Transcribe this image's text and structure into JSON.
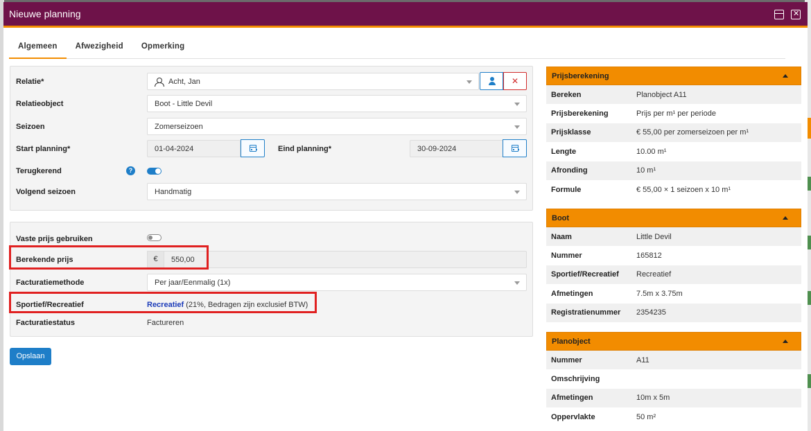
{
  "window": {
    "title": "Nieuwe planning"
  },
  "tabs": [
    {
      "label": "Algemeen",
      "active": true
    },
    {
      "label": "Afwezigheid",
      "active": false
    },
    {
      "label": "Opmerking",
      "active": false
    }
  ],
  "form": {
    "relatie": {
      "label": "Relatie*",
      "value": "Acht, Jan"
    },
    "relatieobject": {
      "label": "Relatieobject",
      "value": "Boot - Little Devil"
    },
    "seizoen": {
      "label": "Seizoen",
      "value": "Zomerseizoen"
    },
    "start_planning": {
      "label": "Start planning*",
      "value": "01-04-2024"
    },
    "eind_planning": {
      "label": "Eind planning*",
      "value": "30-09-2024"
    },
    "terugkerend": {
      "label": "Terugkerend",
      "help": "?",
      "enabled": true
    },
    "volgend_seizoen": {
      "label": "Volgend seizoen",
      "value": "Handmatig"
    }
  },
  "pricing": {
    "vaste_prijs": {
      "label": "Vaste prijs gebruiken",
      "enabled": false
    },
    "berekende_prijs": {
      "label": "Berekende prijs",
      "currency": "€",
      "value": "550,00"
    },
    "facturatiemethode": {
      "label": "Facturatiemethode",
      "value": "Per jaar/Eenmalig (1x)"
    },
    "sportief": {
      "label": "Sportief/Recreatief",
      "link": "Recreatief",
      "note": "(21%, Bedragen zijn exclusief BTW)"
    },
    "facturatiestatus": {
      "label": "Facturatiestatus",
      "value": "Factureren"
    }
  },
  "save_label": "Opslaan",
  "cards": {
    "prijsberekening": {
      "title": "Prijsberekening",
      "rows": [
        {
          "k": "Bereken",
          "v": "Planobject A11"
        },
        {
          "k": "Prijsberekening",
          "v": "Prijs per m¹ per periode"
        },
        {
          "k": "Prijsklasse",
          "v": "€ 55,00 per zomerseizoen per m¹"
        },
        {
          "k": "Lengte",
          "v": "10.00 m¹"
        },
        {
          "k": "Afronding",
          "v": "10 m¹"
        },
        {
          "k": "Formule",
          "v": "€ 55,00 × 1 seizoen x 10 m¹"
        }
      ]
    },
    "boot": {
      "title": "Boot",
      "rows": [
        {
          "k": "Naam",
          "v": "Little Devil"
        },
        {
          "k": "Nummer",
          "v": "165812"
        },
        {
          "k": "Sportief/Recreatief",
          "v": "Recreatief"
        },
        {
          "k": "Afmetingen",
          "v": "7.5m x 3.75m"
        },
        {
          "k": "Registratienummer",
          "v": "2354235"
        }
      ]
    },
    "planobject": {
      "title": "Planobject",
      "rows": [
        {
          "k": "Nummer",
          "v": "A11"
        },
        {
          "k": "Omschrijving",
          "v": ""
        },
        {
          "k": "Afmetingen",
          "v": "10m x 5m"
        },
        {
          "k": "Oppervlakte",
          "v": "50 m²"
        }
      ]
    }
  },
  "colors": {
    "titlebar": "#6e1249",
    "accent": "#f28c00",
    "primary": "#1e7ec8",
    "highlight": "#e02020"
  }
}
